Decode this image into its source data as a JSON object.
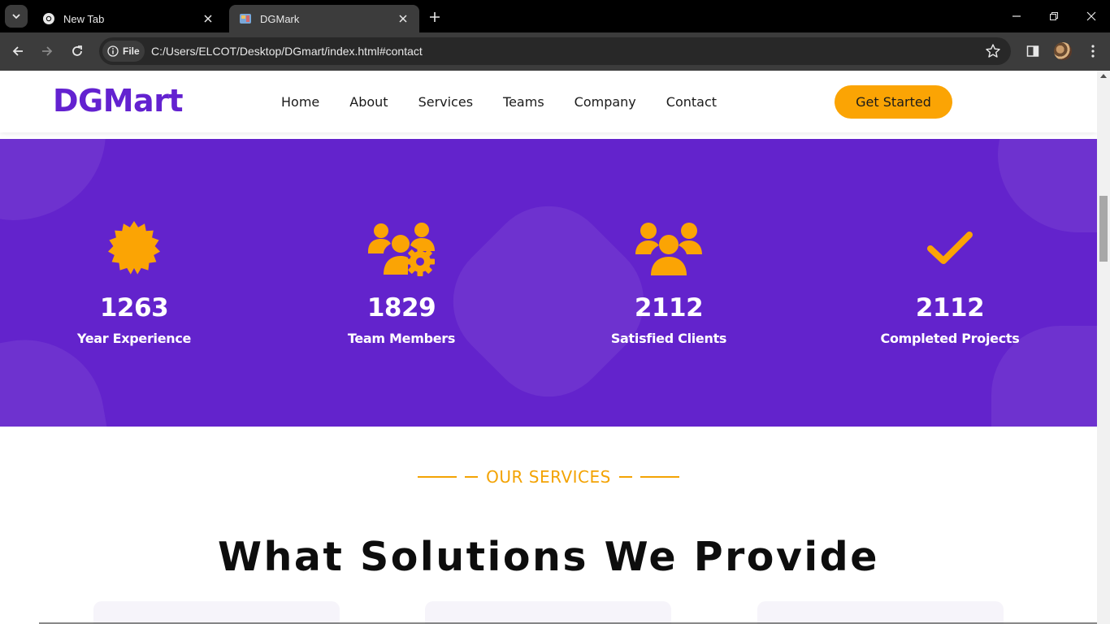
{
  "browser": {
    "tabs": [
      {
        "title": "New Tab",
        "active": false
      },
      {
        "title": "DGMark",
        "active": true
      }
    ],
    "site_chip_label": "File",
    "url": "C:/Users/ELCOT/Desktop/DGmart/index.html#contact"
  },
  "header": {
    "logo": "DGMart",
    "nav": [
      "Home",
      "About",
      "Services",
      "Teams",
      "Company",
      "Contact"
    ],
    "cta_label": "Get Started"
  },
  "stats": [
    {
      "icon": "badge-icon",
      "value": "1263",
      "label": "Year Experience"
    },
    {
      "icon": "team-gear-icon",
      "value": "1829",
      "label": "Team Members"
    },
    {
      "icon": "users-group-icon",
      "value": "2112",
      "label": "Satisfied Clients"
    },
    {
      "icon": "checkmark-icon",
      "value": "2112",
      "label": "Completed Projects"
    }
  ],
  "services": {
    "eyebrow": "OUR SERVICES",
    "title": "What Solutions We Provide"
  },
  "colors": {
    "brand_purple": "#6322d0",
    "stats_bg": "#6323cc",
    "accent_orange": "#fba404"
  }
}
